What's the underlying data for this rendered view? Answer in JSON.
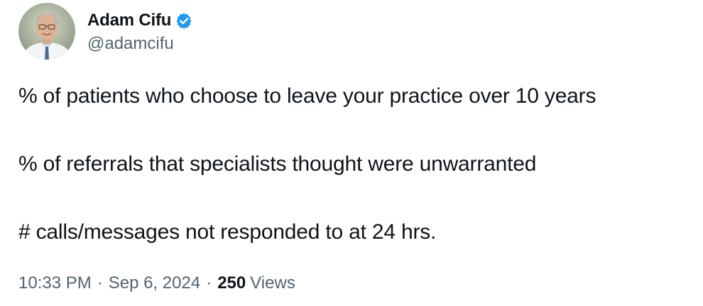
{
  "author": {
    "display_name": "Adam Cifu",
    "handle": "@adamcifu",
    "verified": true,
    "avatar_icon": "profile-photo",
    "verified_icon": "verified-badge-icon",
    "verified_color": "#1d9bf0"
  },
  "tweet": {
    "lines": [
      "% of patients who choose to leave your practice over 10 years",
      "% of referrals that specialists thought were unwarranted",
      "# calls/messages not responded to at 24 hrs."
    ]
  },
  "meta": {
    "time": "10:33 PM",
    "separator": "·",
    "date": "Sep 6, 2024",
    "views_count": "250",
    "views_label": "Views"
  },
  "colors": {
    "text_primary": "#0f1419",
    "text_secondary": "#536471",
    "accent": "#1d9bf0"
  }
}
